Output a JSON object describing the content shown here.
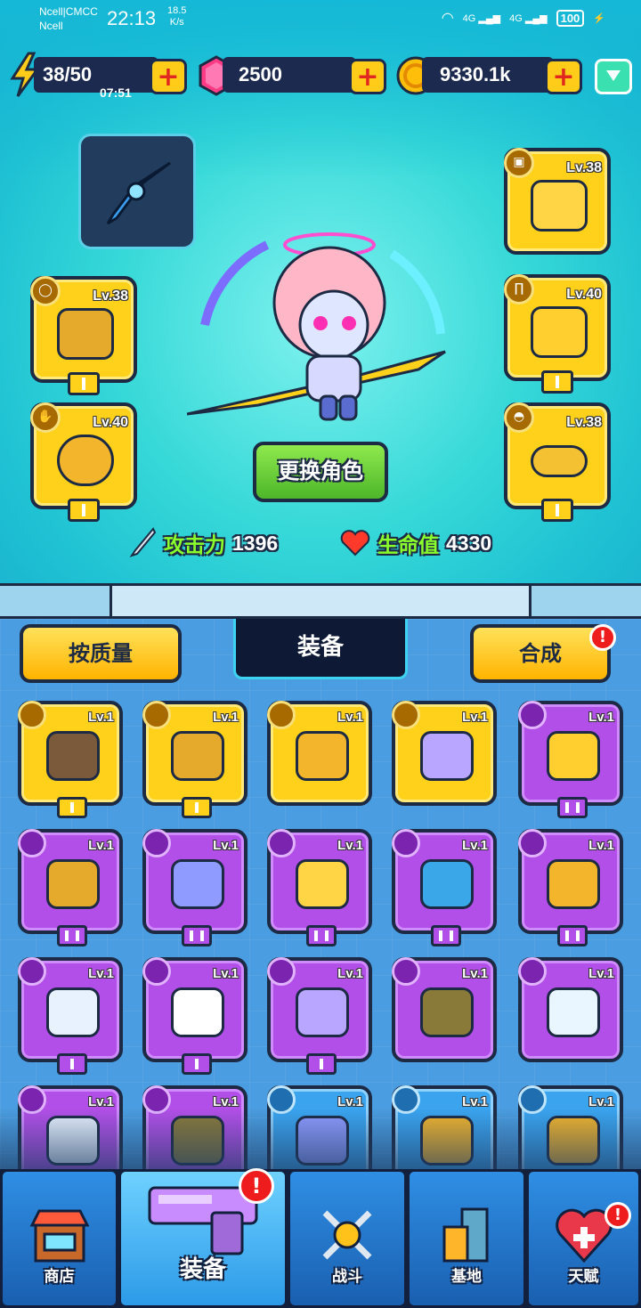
{
  "status_bar": {
    "carrier1": "Ncell|CMCC",
    "carrier2": "Ncell",
    "time": "22:13",
    "speed_value": "18.5",
    "speed_unit": "K/s",
    "net1": "4G",
    "net2": "4G",
    "battery": "100"
  },
  "resources": {
    "energy": "38/50",
    "energy_timer": "07:51",
    "gems": "2500",
    "coins": "9330.1k"
  },
  "equipped": {
    "left": [
      {
        "level": "Lv.38",
        "slot": "necklace"
      },
      {
        "level": "Lv.40",
        "slot": "gloves"
      }
    ],
    "right": [
      {
        "level": "Lv.38",
        "slot": "armor"
      },
      {
        "level": "Lv.40",
        "slot": "pants"
      },
      {
        "level": "Lv.38",
        "slot": "shoes"
      }
    ]
  },
  "change_character_label": "更换角色",
  "stats": {
    "attack_label": "攻击力",
    "attack_value": "1396",
    "hp_label": "生命值",
    "hp_value": "4330"
  },
  "panel": {
    "sort_label": "按质量",
    "title": "装备",
    "merge_label": "合成",
    "merge_alert": "!"
  },
  "inventory": [
    {
      "level": "Lv.1",
      "rarity": "yellow",
      "item": "chest-armor"
    },
    {
      "level": "Lv.1",
      "rarity": "yellow",
      "item": "scarf"
    },
    {
      "level": "Lv.1",
      "rarity": "yellow",
      "item": "glove"
    },
    {
      "level": "Lv.1",
      "rarity": "yellow",
      "item": "boot"
    },
    {
      "level": "Lv.1",
      "rarity": "purple",
      "item": "shorts"
    },
    {
      "level": "Lv.1",
      "rarity": "purple",
      "item": "scarf"
    },
    {
      "level": "Lv.1",
      "rarity": "purple",
      "item": "gauntlet"
    },
    {
      "level": "Lv.1",
      "rarity": "purple",
      "item": "shirt"
    },
    {
      "level": "Lv.1",
      "rarity": "purple",
      "item": "necklace"
    },
    {
      "level": "Lv.1",
      "rarity": "purple",
      "item": "glove"
    },
    {
      "level": "Lv.1",
      "rarity": "purple",
      "item": "vest"
    },
    {
      "level": "Lv.1",
      "rarity": "purple",
      "item": "sock"
    },
    {
      "level": "Lv.1",
      "rarity": "purple",
      "item": "boot"
    },
    {
      "level": "Lv.1",
      "rarity": "purple",
      "item": "hiking-boot"
    },
    {
      "level": "Lv.1",
      "rarity": "purple",
      "item": "briefs"
    },
    {
      "level": "Lv.1",
      "rarity": "purple",
      "item": "vest"
    },
    {
      "level": "Lv.1",
      "rarity": "purple",
      "item": "hiking-boot"
    },
    {
      "level": "Lv.1",
      "rarity": "blue",
      "item": "gauntlet"
    },
    {
      "level": "Lv.1",
      "rarity": "blue",
      "item": "glove"
    },
    {
      "level": "Lv.1",
      "rarity": "blue",
      "item": "glove"
    }
  ],
  "nav": {
    "shop": "商店",
    "equip": "装备",
    "equip_alert": "!",
    "battle": "战斗",
    "base": "基地",
    "talent": "天赋",
    "talent_alert": "!"
  },
  "colors": {
    "bg_top": "#37d9d8",
    "bg_lower": "#4a9de0",
    "outline": "#1d2a44",
    "gold": "#ffd11a",
    "epic": "#b24fe8",
    "rare": "#3aa4ef",
    "stat_green": "#8aff2c"
  }
}
